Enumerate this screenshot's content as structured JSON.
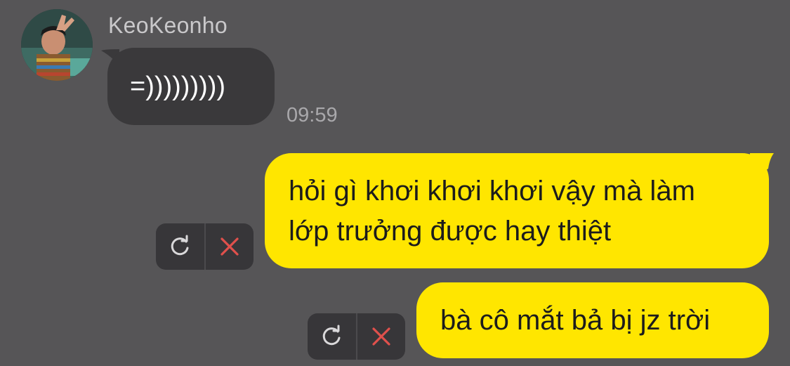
{
  "contact": {
    "name": "KeoKeonho"
  },
  "messages": {
    "incoming": {
      "text": "=)))))))))",
      "time": "09:59"
    },
    "outgoing": [
      {
        "lines": [
          "hỏi gì khơi khơi khơi vậy mà làm",
          "lớp trưởng được hay thiệt"
        ],
        "status": "failed"
      },
      {
        "lines": [
          "bà cô mắt bả bị jz trời"
        ],
        "status": "failed"
      }
    ]
  },
  "icons": {
    "resend": "refresh-icon",
    "delete": "close-icon"
  },
  "colors": {
    "background": "#565557",
    "incoming_bubble": "#3a393b",
    "outgoing_bubble": "#ffe600",
    "delete_icon": "#e0504c",
    "resend_icon": "#d9d8da"
  }
}
